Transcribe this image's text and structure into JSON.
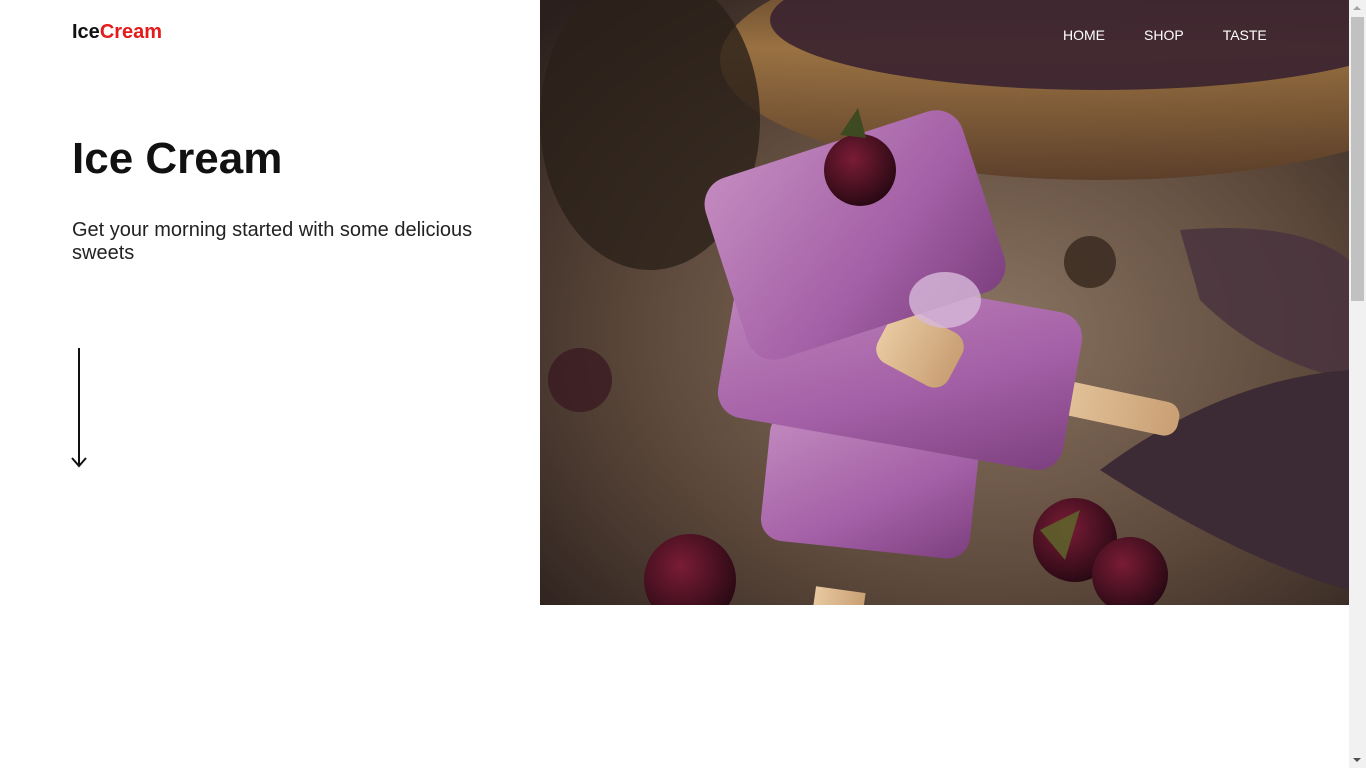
{
  "logo": {
    "part1": "Ice",
    "part2": "Cream",
    "colors": {
      "part1": "#111111",
      "part2": "#e31b1b"
    }
  },
  "nav": {
    "items": [
      "HOME",
      "SHOP",
      "TASTE"
    ]
  },
  "hero": {
    "title": "Ice Cream",
    "subtitle": "Get your morning started with some delicious sweets",
    "scroll_icon": "arrow-down-icon",
    "image": "blackberry-popsicles-photo"
  },
  "colors": {
    "accent": "#e31b1b",
    "text": "#111111",
    "background": "#ffffff"
  }
}
